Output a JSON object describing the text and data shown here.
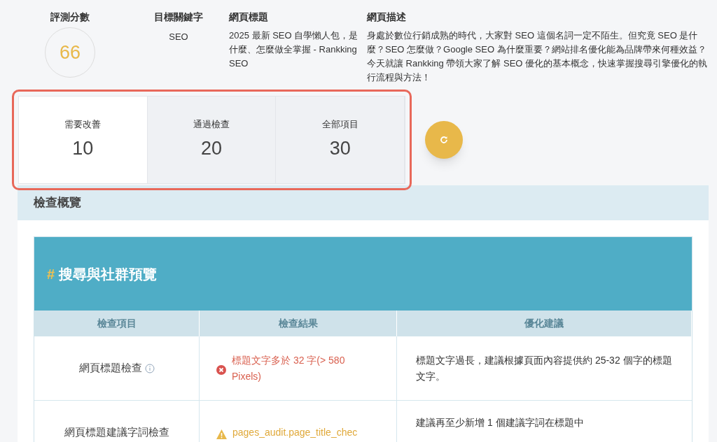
{
  "summary": {
    "score_label": "評測分數",
    "score": "66",
    "keyword_label": "目標關鍵字",
    "keyword": "SEO",
    "title_label": "網頁標題",
    "title": "2025 最新 SEO 自學懶人包，是什麼、怎麼做全掌握 - Rankking SEO",
    "description_label": "網頁描述",
    "description": "身處於數位行銷成熟的時代，大家對 SEO 這個名詞一定不陌生。但究竟 SEO 是什麼？SEO 怎麼做？Google SEO 為什麼重要？網站排名優化能為品牌帶來何種效益？今天就讓 Rankking 帶領大家了解 SEO 優化的基本概念，快速掌握搜尋引擎優化的執行流程與方法！"
  },
  "stats": [
    {
      "label": "需要改善",
      "value": "10",
      "selected": true
    },
    {
      "label": "通過檢查",
      "value": "20",
      "selected": false
    },
    {
      "label": "全部項目",
      "value": "30",
      "selected": false
    }
  ],
  "overview": {
    "title": "檢查概覽",
    "section": {
      "hash": "#",
      "title": "搜尋與社群預覽"
    },
    "columns": [
      "檢查項目",
      "檢查結果",
      "優化建議"
    ],
    "rows": [
      {
        "item": "網頁標題檢查",
        "kind": "error",
        "result": "標題文字多於 32 字(> 580 Pixels)",
        "advice": "標題文字過長，建議根據頁面內容提供約 25-32 個字的標題文字。"
      },
      {
        "item": "網頁標題建議字詞檢查",
        "kind": "warning",
        "result": "pages_audit.page_title_chec",
        "advice": "建議再至少新增 1 個建議字詞在標題中"
      }
    ]
  }
}
